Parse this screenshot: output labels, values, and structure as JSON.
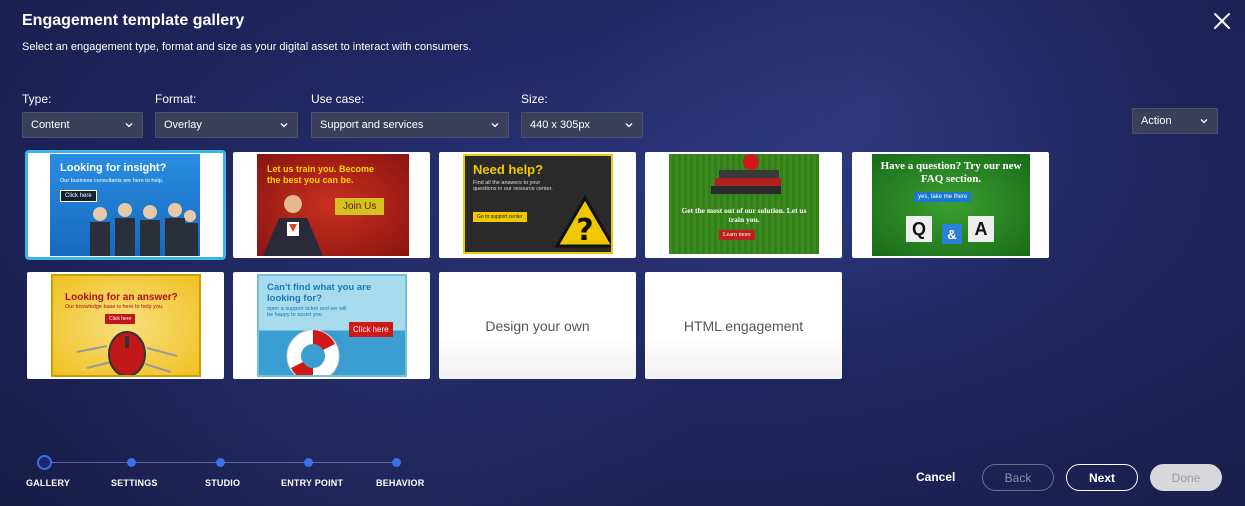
{
  "header": {
    "title": "Engagement template gallery",
    "subtitle": "Select an engagement type, format and size as your digital asset to interact with consumers."
  },
  "filters": {
    "type": {
      "label": "Type:",
      "value": "Content"
    },
    "format": {
      "label": "Format:",
      "value": "Overlay"
    },
    "use_case": {
      "label": "Use case:",
      "value": "Support and services"
    },
    "size": {
      "label": "Size:",
      "value": "440 x 305px"
    },
    "action": {
      "value": "Action"
    }
  },
  "templates": [
    {
      "title": "Looking for insight?",
      "sub": "Our business consultants are here to help.",
      "button": "Click here",
      "selected": true
    },
    {
      "title": "Let us train you. Become the best you can be.",
      "button": "Join Us"
    },
    {
      "title": "Need help?",
      "sub": "Find all the answers to your questions in our resource center.",
      "button": "Go to support center"
    },
    {
      "title": "Get the most out of our solution. Let us train you.",
      "button": "Learn more"
    },
    {
      "title": "Have a question? Try our new FAQ section.",
      "button": "yes, take me there",
      "letters": [
        "Q",
        "&",
        "A"
      ]
    },
    {
      "title": "Looking for an answer?",
      "sub": "Our knowledge base is here to help you.",
      "button": "Click here"
    },
    {
      "title": "Can't find what you are looking for?",
      "sub": "open a support ticket and we will be happy to assist you",
      "button": "Click here"
    },
    {
      "title": "Design your own"
    },
    {
      "title": "HTML engagement"
    }
  ],
  "wizard": {
    "steps": [
      "GALLERY",
      "SETTINGS",
      "STUDIO",
      "ENTRY POINT",
      "BEHAVIOR"
    ],
    "current": "GALLERY"
  },
  "footer": {
    "cancel": "Cancel",
    "back": "Back",
    "next": "Next",
    "done": "Done"
  },
  "colors": {
    "background": "#1b2150",
    "selected_outline": "#3ab6ef",
    "step_dot": "#3b6fe8"
  }
}
